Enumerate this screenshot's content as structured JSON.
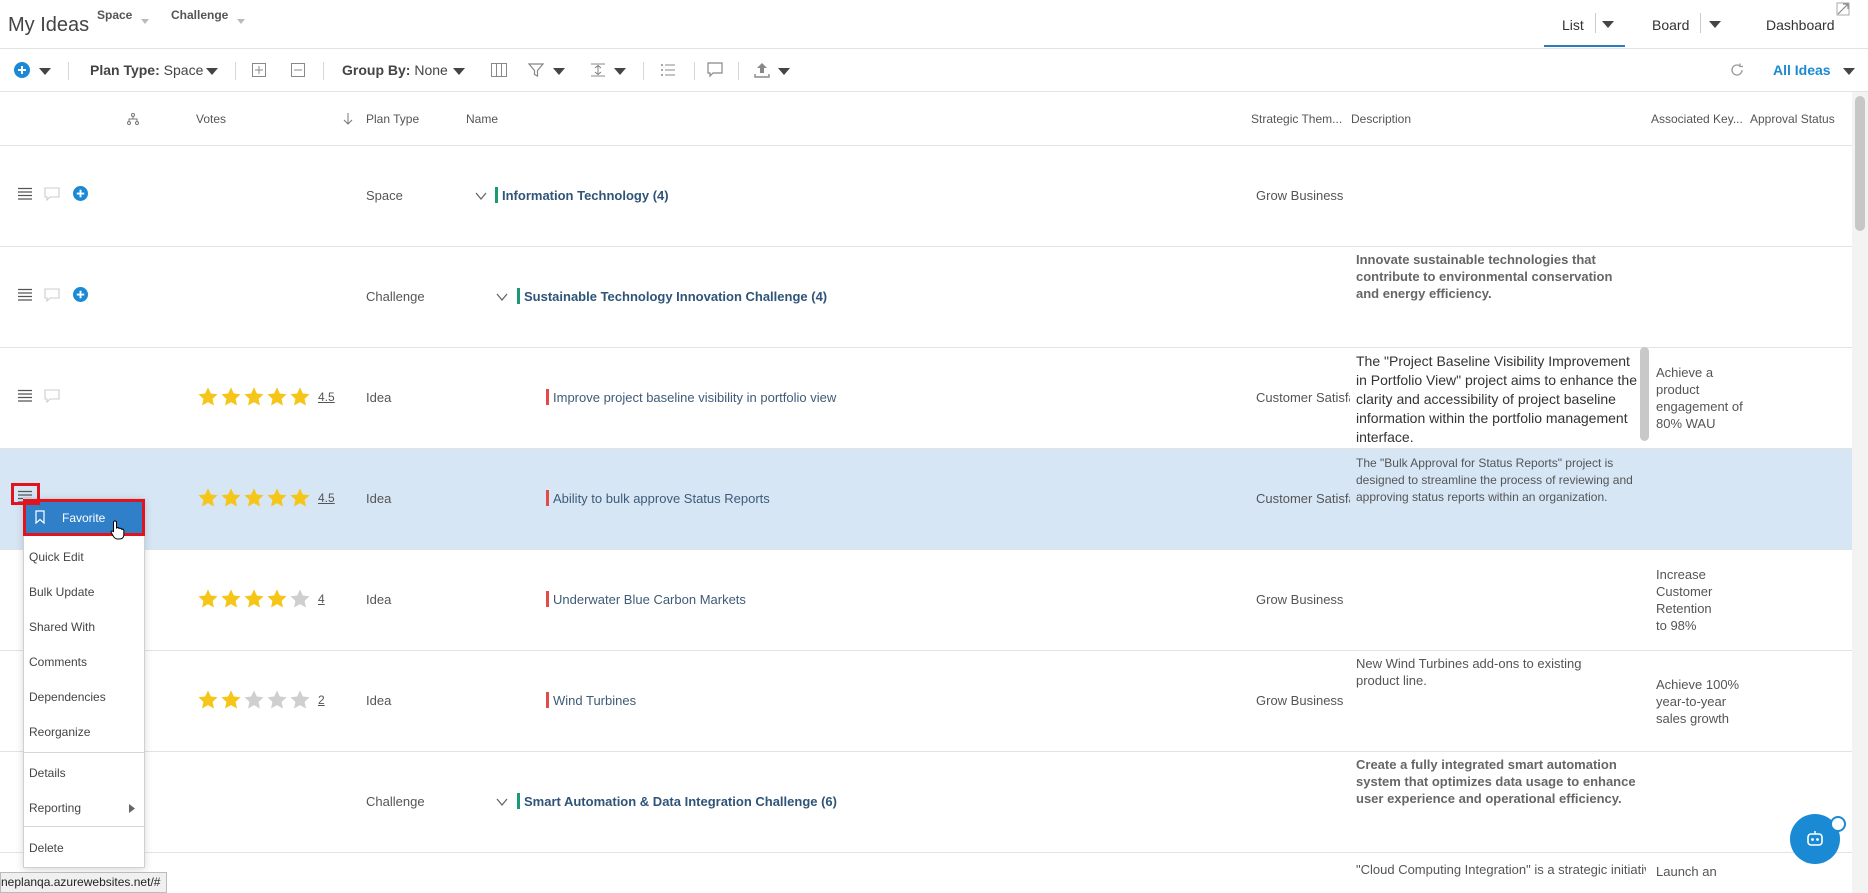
{
  "header": {
    "title": "My Ideas",
    "breadcrumb": [
      "Space",
      "Challenge"
    ],
    "views": {
      "list": "List",
      "board": "Board",
      "dashboard": "Dashboard"
    }
  },
  "toolbar": {
    "plan_type_label": "Plan Type:",
    "plan_type_value": "Space",
    "group_by_label": "Group By:",
    "group_by_value": "None",
    "filter_label": "All Ideas"
  },
  "columns": {
    "votes": "Votes",
    "plan_type": "Plan Type",
    "name": "Name",
    "strategic_theme": "Strategic Them...",
    "description": "Description",
    "associated_key": "Associated Key...",
    "approval_status": "Approval Status"
  },
  "rows": [
    {
      "plan_type": "Space",
      "name": "Information Technology (4)",
      "strategic_theme": "Grow Business",
      "description": ""
    },
    {
      "plan_type": "Challenge",
      "name": "Sustainable Technology Innovation Challenge (4)",
      "strategic_theme": "",
      "description": "Innovate sustainable technologies that contribute to environmental conservation and energy efficiency."
    },
    {
      "plan_type": "Idea",
      "rating": 4.5,
      "rating_label": "4.5",
      "name": "Improve project baseline visibility in portfolio view",
      "strategic_theme": "Customer Satisfa",
      "description": "The \"Project Baseline Visibility Improvement in Portfolio View\" project aims to enhance the clarity and accessibility of project baseline information within the portfolio management interface.",
      "key_result": "Achieve a product engagement of 80% WAU"
    },
    {
      "plan_type": "Idea",
      "rating": 4.5,
      "rating_label": "4.5",
      "name": "Ability to bulk approve Status Reports",
      "strategic_theme": "Customer Satisfa",
      "description": "The \"Bulk Approval for Status Reports\" project is designed to streamline the process of reviewing and approving status reports within an organization."
    },
    {
      "plan_type": "Idea",
      "rating": 4,
      "rating_label": "4",
      "name": "Underwater Blue Carbon Markets",
      "strategic_theme": "Grow Business",
      "description": "",
      "key_result": "Increase Customer Retention to 98%"
    },
    {
      "plan_type": "Idea",
      "rating": 2,
      "rating_label": "2",
      "name": "Wind Turbines",
      "strategic_theme": "Grow Business",
      "description": "New Wind Turbines add-ons to existing product line.",
      "key_result": "Achieve 100% year-to-year sales growth"
    },
    {
      "plan_type": "Challenge",
      "name": "Smart Automation & Data Integration Challenge (6)",
      "strategic_theme": "",
      "description": "Create a fully integrated smart automation system that optimizes data usage to enhance user experience and operational efficiency."
    },
    {
      "description": "\"Cloud Computing Integration\" is a strategic initiative",
      "key_result": "Launch an"
    }
  ],
  "context_menu": {
    "favorite": "Favorite",
    "items": [
      "Quick Edit",
      "Bulk Update",
      "Shared With",
      "Comments",
      "Dependencies",
      "Reorganize"
    ],
    "details": "Details",
    "reporting": "Reporting",
    "delete": "Delete"
  },
  "status_url": "neplanqa.azurewebsites.net/#",
  "colors": {
    "accent": "#1a8ad4",
    "selected_row": "#d6e6f5",
    "idea_bar": "#e34a4a",
    "group_bar": "#1b9a7a",
    "star": "#f5c518",
    "star_empty": "#cfcfcf"
  }
}
